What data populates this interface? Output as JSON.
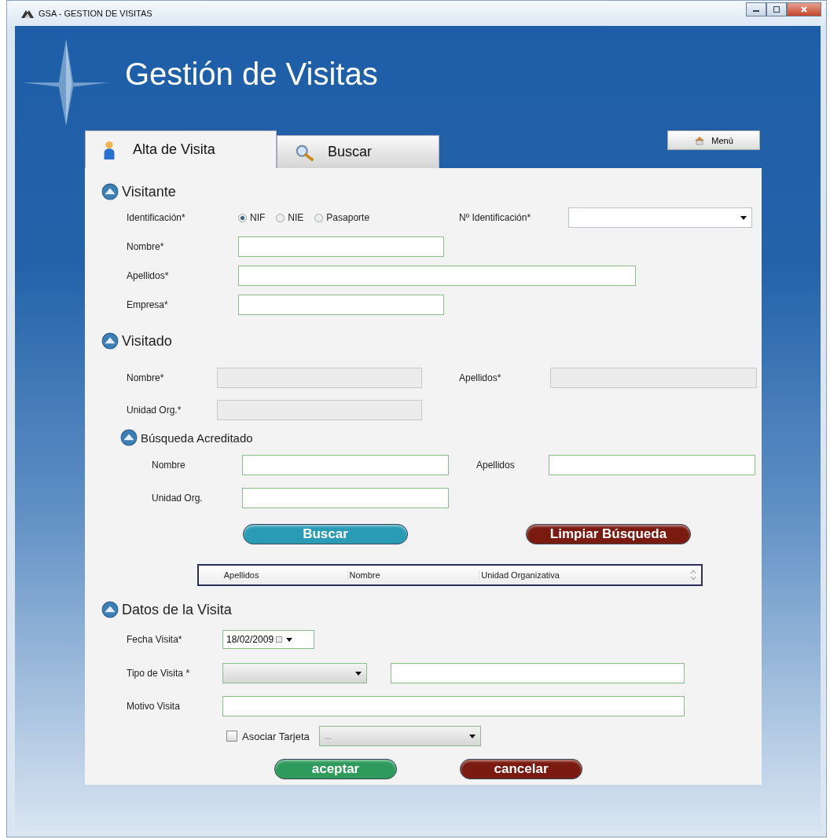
{
  "window": {
    "title": "GSA - GESTION DE VISITAS"
  },
  "header": {
    "title": "Gestión de Visitas"
  },
  "tabs": [
    {
      "label": "Alta de Visita",
      "kind": "person",
      "selected": true
    },
    {
      "label": "Buscar",
      "kind": "search",
      "selected": false
    }
  ],
  "menu_button": {
    "label": "Menú"
  },
  "visitante": {
    "title": "Visitante",
    "identification": {
      "label": "Identificación*",
      "options": [
        {
          "label": "NIF",
          "selected": true
        },
        {
          "label": "NIE",
          "selected": false
        },
        {
          "label": "Pasaporte",
          "selected": false
        }
      ]
    },
    "id_number": {
      "label": "Nº Identificación*"
    },
    "fields": [
      {
        "label": "Nombre*"
      },
      {
        "label": "Apellidos*"
      },
      {
        "label": "Empresa*"
      }
    ]
  },
  "visitado": {
    "title": "Visitado",
    "fields": [
      {
        "label": "Nombre*"
      },
      {
        "label": "Apellidos*"
      },
      {
        "label": "Unidad Org.*"
      }
    ]
  },
  "busqueda": {
    "title": "Búsqueda Acreditado",
    "fields": [
      {
        "label": "Nombre"
      },
      {
        "label": "Apellidos"
      },
      {
        "label": "Unidad Org."
      }
    ],
    "buttons": [
      {
        "label": "Buscar",
        "color": "#2a9bb5"
      },
      {
        "label": "Limpiar Búsqueda",
        "color": "#7a1a10"
      }
    ],
    "table": {
      "columns": [
        "Apellidos",
        "Nombre",
        "Unidad Organizativa"
      ]
    }
  },
  "datos": {
    "title": "Datos de la Visita",
    "fecha": {
      "label": "Fecha Visita*",
      "value": "18/02/2009"
    },
    "tipo": {
      "label": "Tipo de Visita *"
    },
    "motivo": {
      "label": "Motivo Visita"
    },
    "asociar": {
      "label": "Asociar Tarjeta",
      "checked": false,
      "value": "..."
    },
    "buttons": [
      {
        "label": "aceptar",
        "color": "#2e9a5c"
      },
      {
        "label": "cancelar",
        "color": "#7a1a10"
      }
    ]
  }
}
